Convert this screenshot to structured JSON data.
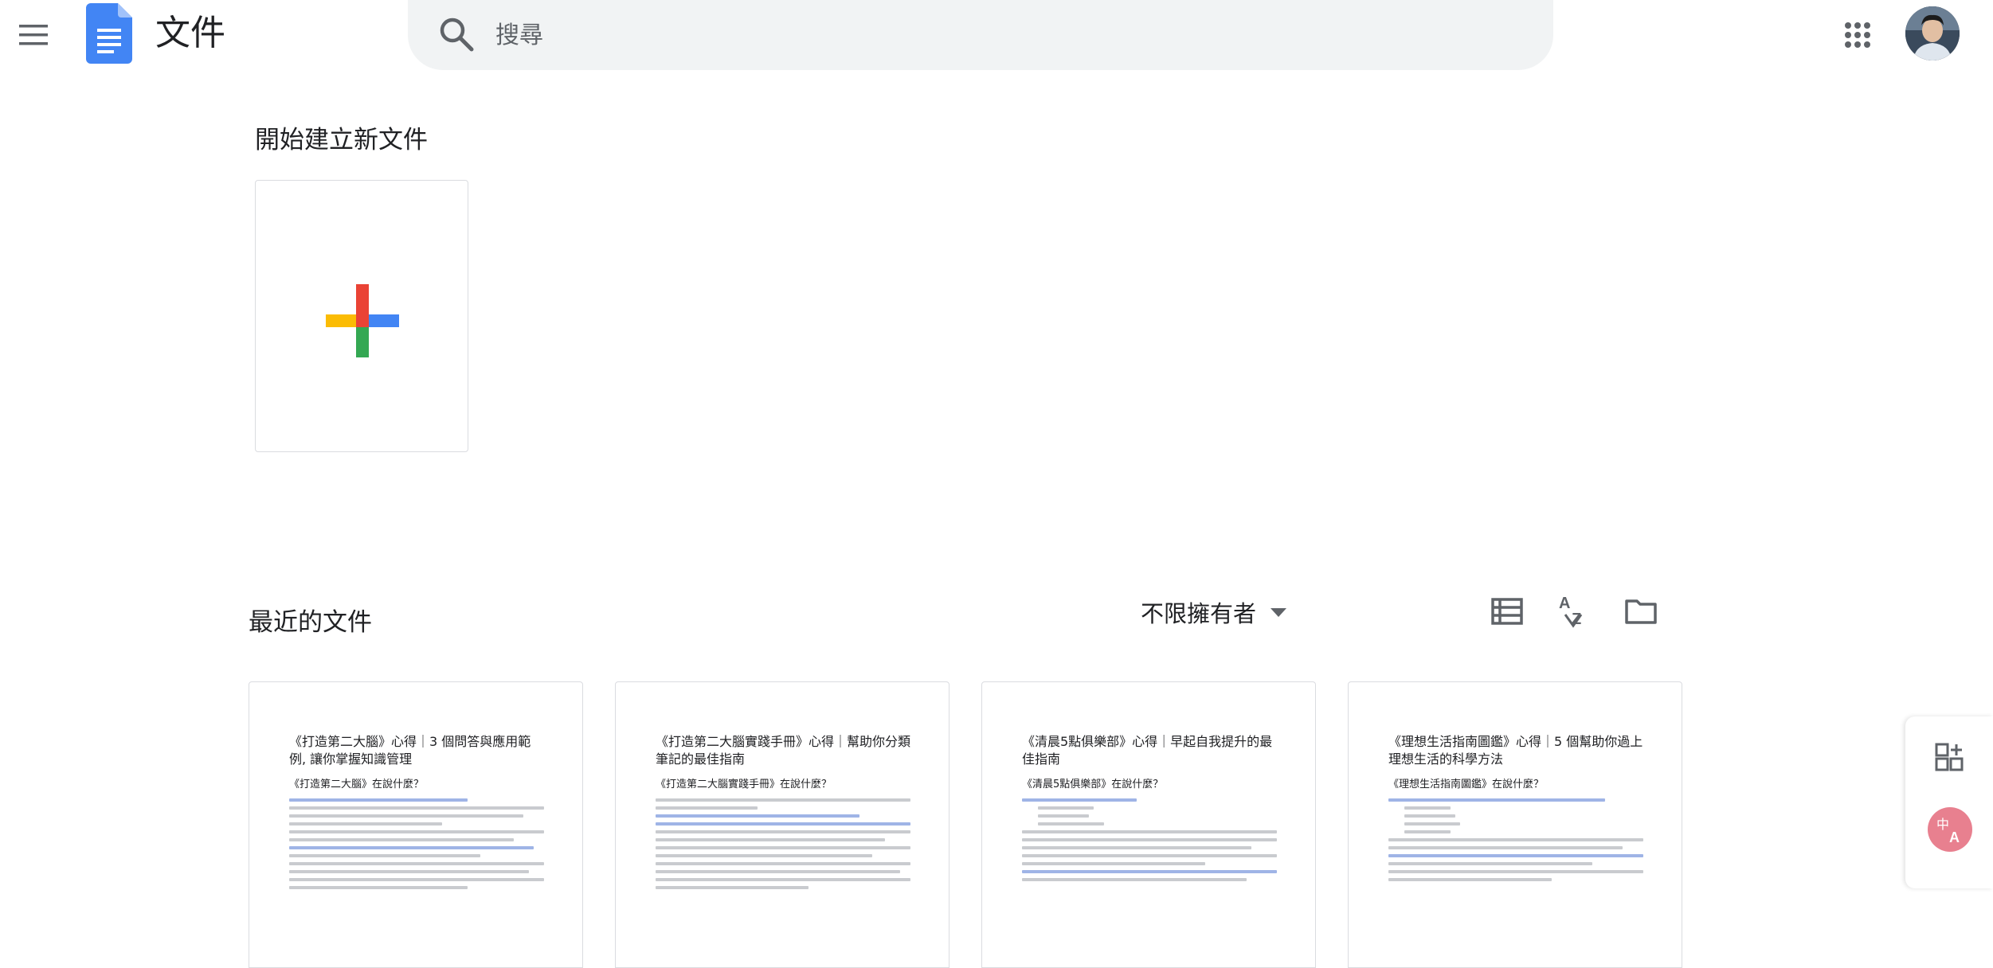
{
  "header": {
    "app_title": "文件",
    "menu_icon": "hamburger-menu-icon",
    "logo_icon": "google-docs-logo",
    "search": {
      "placeholder": "搜尋",
      "icon": "search-icon"
    },
    "apps_icon": "apps-grid-icon",
    "avatar_icon": "avatar"
  },
  "new_section": {
    "title": "開始建立新文件",
    "blank_icon": "plus-icon"
  },
  "recent_section": {
    "title": "最近的文件",
    "owner_filter": "不限擁有者",
    "tools": [
      "list-view-icon",
      "sort-az-icon",
      "folder-icon"
    ]
  },
  "documents": [
    {
      "title": "《打造第二大腦》心得｜3 個問答與應用範例, 讓你掌握知識管理",
      "heading": "《打造第二大腦》在說什麼？"
    },
    {
      "title": "《打造第二大腦實踐手冊》心得｜幫助你分類筆記的最佳指南",
      "heading": "《打造第二大腦實踐手冊》在說什麼？"
    },
    {
      "title": "《清晨5點俱樂部》心得｜早起自我提升的最佳指南",
      "heading": "《清晨5點俱樂部》在說什麼？"
    },
    {
      "title": "《理想生活指南圖鑑》心得｜5 個幫助你過上理想生活的科學方法",
      "heading": "《理想生活指南圖鑑》在說什麼？"
    }
  ],
  "side_tools": [
    "add-widget-icon",
    "translate-icon"
  ],
  "colors": {
    "docs_blue": "#4285f4",
    "plus_red": "#ea4335",
    "plus_yellow": "#fbbc04",
    "plus_green": "#34a853",
    "search_bg": "#f1f3f4",
    "translate_pink": "#e8808f"
  }
}
